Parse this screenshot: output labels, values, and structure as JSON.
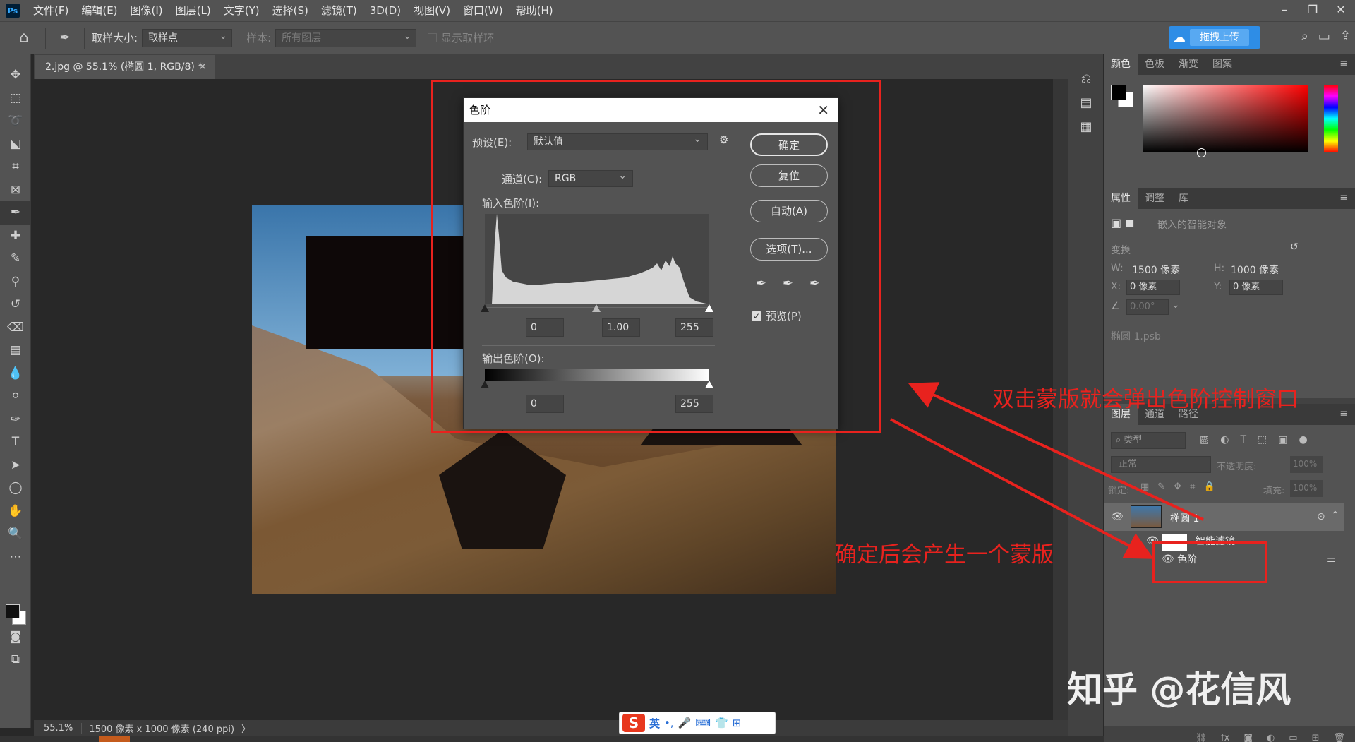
{
  "menubar": {
    "logo": "Ps",
    "items": [
      "文件(F)",
      "编辑(E)",
      "图像(I)",
      "图层(L)",
      "文字(Y)",
      "选择(S)",
      "滤镜(T)",
      "3D(D)",
      "视图(V)",
      "窗口(W)",
      "帮助(H)"
    ]
  },
  "options": {
    "sample_size_label": "取样大小:",
    "sample_size_value": "取样点",
    "sample_label": "样本:",
    "sample_value": "所有图层",
    "show_ring_label": "显示取样环",
    "cloud_upload": "拖拽上传"
  },
  "document": {
    "tab_title": "2.jpg @ 55.1% (椭圆 1, RGB/8) *",
    "zoom": "55.1%",
    "info": "1500 像素 x 1000 像素 (240 ppi)"
  },
  "levels_dialog": {
    "title": "色阶",
    "preset_label": "预设(E):",
    "preset_value": "默认值",
    "channel_label": "通道(C):",
    "channel_value": "RGB",
    "input_label": "输入色阶(I):",
    "input_black": "0",
    "input_gamma": "1.00",
    "input_white": "255",
    "output_label": "输出色阶(O):",
    "output_black": "0",
    "output_white": "255",
    "ok": "确定",
    "reset": "复位",
    "auto": "自动(A)",
    "options": "选项(T)...",
    "preview": "预览(P)"
  },
  "panels": {
    "color_tabs": [
      "颜色",
      "色板",
      "渐变",
      "图案"
    ],
    "props_tabs": [
      "属性",
      "调整",
      "库"
    ],
    "props_kind": "嵌入的智能对象",
    "transform_label": "变换",
    "w_label": "W:",
    "w_value": "1500 像素",
    "h_label": "H:",
    "h_value": "1000 像素",
    "x_label": "X:",
    "x_value": "0 像素",
    "y_label": "Y:",
    "y_value": "0 像素",
    "angle_value": "0.00°",
    "file_name": "椭圆 1.psb",
    "layers_tabs": [
      "图层",
      "通道",
      "路径"
    ],
    "filter_type": "类型",
    "blend_mode": "正常",
    "opacity_label": "不透明度:",
    "opacity_value": "100%",
    "lock_label": "锁定:",
    "fill_label": "填充:",
    "fill_value": "100%",
    "layer_name": "椭圆 1",
    "smart_filters": "智能滤镜",
    "levels_filter": "色阶"
  },
  "ime": {
    "lang": "英"
  },
  "annotations": {
    "text1": "双击蒙版就会弹出色阶控制窗口",
    "text2": "确定后会产生一个蒙版",
    "watermark": "知乎 @花信风",
    "color": "#e8221e"
  }
}
